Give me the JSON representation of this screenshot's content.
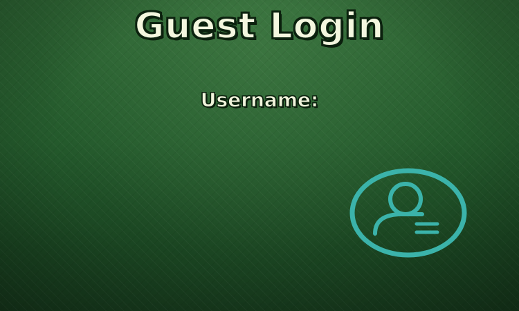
{
  "login": {
    "title": "Guest Login",
    "username_label": "Username:"
  },
  "icons": {
    "user_button": "user-profile-icon"
  },
  "colors": {
    "accent": "#3bb3aa",
    "title_text": "#f4f7df",
    "background": "#245a2c"
  }
}
